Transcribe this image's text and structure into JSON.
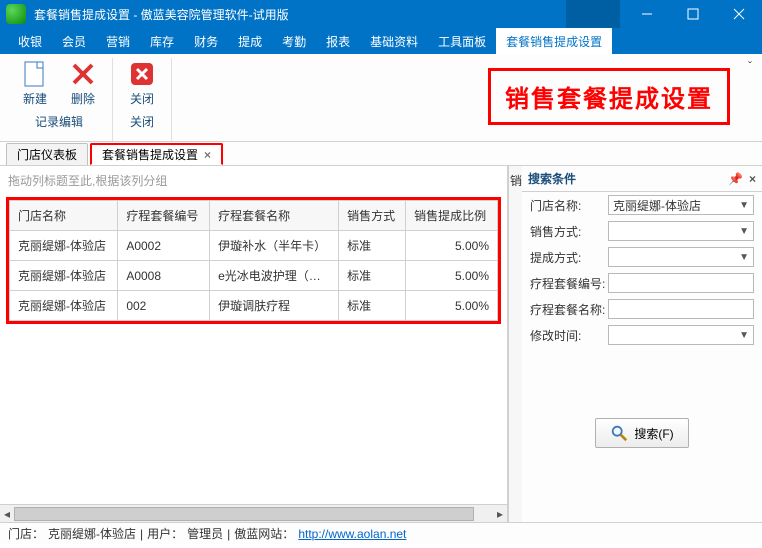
{
  "window": {
    "title": "套餐销售提成设置 - 傲蓝美容院管理软件-试用版"
  },
  "menubar": {
    "items": [
      "收银",
      "会员",
      "营销",
      "库存",
      "财务",
      "提成",
      "考勤",
      "报表",
      "基础资料",
      "工具面板",
      "套餐销售提成设置"
    ],
    "active_index": 10
  },
  "ribbon": {
    "groups": [
      {
        "label": "记录编辑",
        "buttons": [
          {
            "label": "新建",
            "icon": "file"
          },
          {
            "label": "删除",
            "icon": "delete"
          }
        ]
      },
      {
        "label": "关闭",
        "buttons": [
          {
            "label": "关闭",
            "icon": "close"
          }
        ]
      }
    ],
    "highlight_title": "销售套餐提成设置"
  },
  "tabs": {
    "items": [
      {
        "label": "门店仪表板",
        "closable": false
      },
      {
        "label": "套餐销售提成设置",
        "closable": true
      }
    ],
    "active_index": 1
  },
  "grid": {
    "group_hint": "拖动列标题至此,根据该列分组",
    "columns": [
      "门店名称",
      "疗程套餐编号",
      "疗程套餐名称",
      "销售方式",
      "销售提成比例"
    ],
    "extra_col_hint": "销",
    "rows": [
      {
        "store": "克丽缇娜-体验店",
        "code": "A0002",
        "name": "伊璇补水（半年卡）",
        "method": "标准",
        "ratio": "5.00%"
      },
      {
        "store": "克丽缇娜-体验店",
        "code": "A0008",
        "name": "e光冰电波护理（…",
        "method": "标准",
        "ratio": "5.00%"
      },
      {
        "store": "克丽缇娜-体验店",
        "code": "002",
        "name": "伊璇调肤疗程",
        "method": "标准",
        "ratio": "5.00%"
      }
    ]
  },
  "search": {
    "title": "搜索条件",
    "fields": {
      "store_label": "门店名称:",
      "store_value": "克丽缇娜-体验店",
      "method_label": "销售方式:",
      "method_value": "",
      "commission_label": "提成方式:",
      "commission_value": "",
      "code_label": "疗程套餐编号:",
      "code_value": "",
      "name_label": "疗程套餐名称:",
      "name_value": "",
      "modtime_label": "修改时间:",
      "modtime_value": ""
    },
    "button_label": "搜索(F)"
  },
  "status": {
    "store_label": "门店：",
    "store_value": "克丽缇娜-体验店",
    "sep": " | ",
    "user_label": "用户：",
    "user_value": "管理员",
    "site_label": "傲蓝网站：",
    "site_url": "http://www.aolan.net"
  }
}
